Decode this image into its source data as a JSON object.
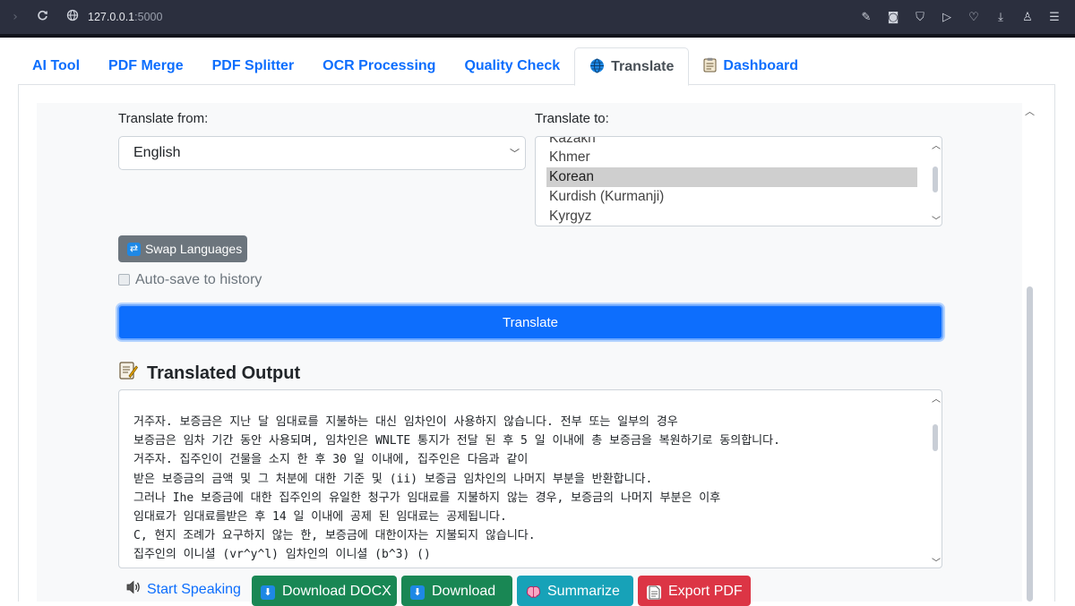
{
  "browser": {
    "url_host": "127.0.0.1",
    "url_port": ":5000"
  },
  "tabs": [
    {
      "label": "AI Tool",
      "icon": ""
    },
    {
      "label": "PDF Merge",
      "icon": ""
    },
    {
      "label": "PDF Splitter",
      "icon": ""
    },
    {
      "label": "OCR Processing",
      "icon": ""
    },
    {
      "label": "Quality Check",
      "icon": ""
    },
    {
      "label": "Translate",
      "icon": "globe-icon"
    },
    {
      "label": "Dashboard",
      "icon": "clipboard-icon"
    }
  ],
  "active_tab": "Translate",
  "form": {
    "from_label": "Translate from:",
    "from_value": "English",
    "to_label": "Translate to:",
    "to_options": [
      "Kazakh",
      "Khmer",
      "Korean",
      "Kurdish (Kurmanji)",
      "Kyrgyz"
    ],
    "to_selected": "Korean",
    "swap_label": "Swap Languages",
    "autosave_label": "Auto-save to history",
    "autosave_checked": false,
    "translate_label": "Translate"
  },
  "output": {
    "title": "Translated Output",
    "lines": [
      "거주자. 보증금은 지난 달 임대료를 지불하는 대신 임차인이 사용하지 않습니다. 전부 또는 일부의 경우",
      "보증금은 임차 기간 동안 사용되며, 임차인은 WNLTE 통지가 전달 된 후 5 일 이내에 총 보증금을 복원하기로 동의합니다.",
      "거주자. 집주인이 건물을 소지 한 후 30 일 이내에, 집주인은 다음과 같이",
      "받은 보증금의 금액 및 그 처분에 대한 기준 및 (ii) 보증금 임차인의 나머지 부분을 반환합니다.",
      "그러나 Ihe 보증금에 대한 집주인의 유일한 청구가 임대료를 지불하지 않는 경우, 보증금의 나머지 부분은 이후",
      "임대료가 임대료를받은 후 14 일 이내에 공제 된 임대료는 공제됩니다.",
      "C, 현지 조례가 요구하지 않는 한, 보증금에 대한이자는 지불되지 않습니다.",
      "집주인의 이니셜 (vr^y^l) 임차인의 이니셜 (b^3) ()"
    ]
  },
  "actions": {
    "speak_label": "Start Speaking",
    "docx_label": "Download DOCX",
    "download_label": "Download",
    "summarize_label": "Summarize",
    "pdf_label": "Export PDF"
  },
  "colors": {
    "primary": "#0d6efd",
    "success": "#198754",
    "info": "#17a2b8",
    "danger": "#dc3545",
    "secondary": "#6c757d"
  }
}
